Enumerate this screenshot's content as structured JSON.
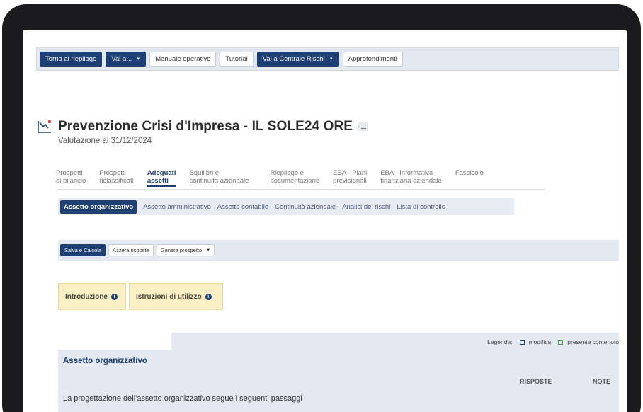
{
  "toolbar": {
    "back_label": "Torna al riepilogo",
    "goto_label": "Vai a...",
    "manual_label": "Manuale operativo",
    "tutorial_label": "Tutorial",
    "cr_label": "Vai a Centrale Rischi",
    "insights_label": "Approfondimenti"
  },
  "header": {
    "title": "Prevenzione Crisi d'Impresa - IL SOLE24 ORE",
    "subtitle": "Valutazione al 31/12/2024"
  },
  "main_tabs": [
    {
      "line1": "Prospetti",
      "line2": "di bilancio"
    },
    {
      "line1": "Prospetti",
      "line2": "riclassificati"
    },
    {
      "line1": "Adeguati",
      "line2": "assetti"
    },
    {
      "line1": "Squilibri e",
      "line2": "continuità aziendale"
    },
    {
      "line1": "Riepilogo e",
      "line2": "documentazione"
    },
    {
      "line1": "EBA - Piani",
      "line2": "previsionali"
    },
    {
      "line1": "EBA - Informativa",
      "line2": "finanziaria aziendale"
    },
    {
      "line1": "Fascicolo",
      "line2": ""
    }
  ],
  "sub_tabs": [
    "Assetto organizzativo",
    "Assetto amministrativo",
    "Assetto contabile",
    "Continuità aziendale",
    "Analisi dei rischi",
    "Lista di controllo"
  ],
  "actions": {
    "save_label": "Salva e Calcola",
    "reset_label": "Azzera risposte",
    "generate_label": "Genera prospetto"
  },
  "info": {
    "intro_label": "Introduzione",
    "instructions_label": "Istruzioni di utilizzo"
  },
  "panel": {
    "legend_label": "Legenda:",
    "legend_edit": "modifica",
    "legend_content": "presente contenuto",
    "section_title": "Assetto organizzativo",
    "col_answers": "RISPOSTE",
    "col_notes": "NOTE",
    "question": "La progettazione dell'assetto organizzativo segue i seguenti passaggi"
  },
  "colors": {
    "accent": "#1d3f73",
    "info_bg": "#fbefc5",
    "bar_bg": "#e4e9f1",
    "legend_green": "#49a347"
  },
  "icons": [
    "chart-down-icon",
    "menu-icon",
    "info-icon",
    "edit-square-icon",
    "content-square-icon",
    "caret-down-icon"
  ]
}
